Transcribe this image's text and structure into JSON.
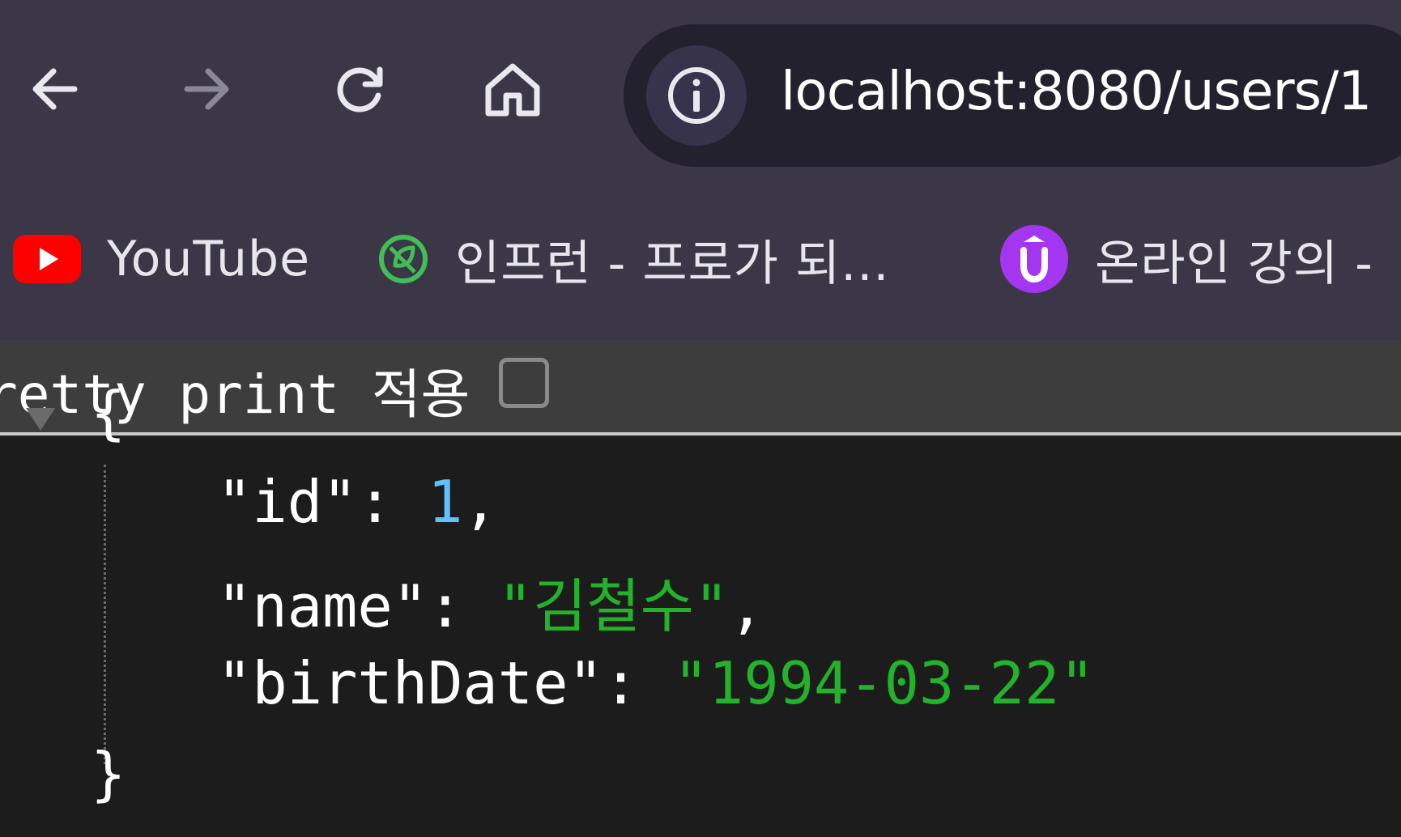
{
  "browser": {
    "url": "localhost:8080/users/1",
    "nav": {
      "back_icon": "arrow-left-icon",
      "forward_icon": "arrow-right-icon",
      "reload_icon": "reload-icon",
      "home_icon": "home-icon",
      "site_info_icon": "info-icon"
    }
  },
  "bookmarks": [
    {
      "label": "YouTube",
      "icon": "youtube-icon",
      "color": "#ff0000"
    },
    {
      "label": "인프런 - 프로가 되...",
      "icon": "inflearn-leaf-icon",
      "color": "#3fbf55"
    },
    {
      "label": "온라인 강의 -",
      "icon": "udemy-icon",
      "color": "#a435f0"
    }
  ],
  "pretty_print": {
    "label": "retty print 적용",
    "checked": false
  },
  "json_view": {
    "open_brace": "{",
    "close_brace": "}",
    "lines": [
      {
        "key": "\"id\"",
        "colon": ": ",
        "value": "1",
        "suffix": ","
      },
      {
        "key": "\"name\"",
        "colon": ": ",
        "value": "\"김철수\"",
        "suffix": ","
      },
      {
        "key": "\"birthDate\"",
        "colon": ": ",
        "value": "\"1994-03-22\"",
        "suffix": ""
      }
    ],
    "colors": {
      "number": "#5fc1ff",
      "string": "#22b32a",
      "key": "#ffffff"
    }
  }
}
